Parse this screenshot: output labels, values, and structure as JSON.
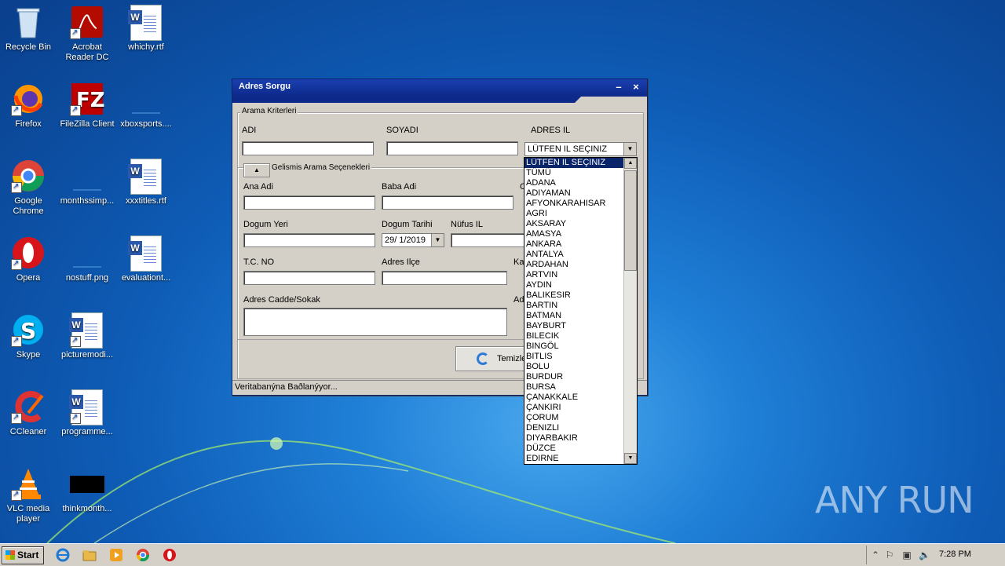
{
  "desktop": {
    "icons": [
      {
        "label": "Recycle Bin",
        "icon": "recycle-bin-icon"
      },
      {
        "label": "Acrobat Reader DC",
        "icon": "acrobat-icon"
      },
      {
        "label": "whichy.rtf",
        "icon": "word-doc-icon"
      },
      {
        "label": "Firefox",
        "icon": "firefox-icon"
      },
      {
        "label": "FileZilla Client",
        "icon": "filezilla-icon"
      },
      {
        "label": "xboxsports....",
        "icon": "blank-file-icon"
      },
      {
        "label": "Google Chrome",
        "icon": "chrome-icon"
      },
      {
        "label": "monthssimp...",
        "icon": "blank-file-icon"
      },
      {
        "label": "xxxtitles.rtf",
        "icon": "word-doc-icon"
      },
      {
        "label": "Opera",
        "icon": "opera-icon"
      },
      {
        "label": "nostuff.png",
        "icon": "blank-file-icon"
      },
      {
        "label": "evaluationt...",
        "icon": "word-doc-icon"
      },
      {
        "label": "Skype",
        "icon": "skype-icon"
      },
      {
        "label": "picturemodi...",
        "icon": "word-doc-icon"
      },
      {
        "label": "CCleaner",
        "icon": "ccleaner-icon"
      },
      {
        "label": "programme...",
        "icon": "word-doc-icon"
      },
      {
        "label": "VLC media player",
        "icon": "vlc-icon"
      },
      {
        "label": "thinkmonth...",
        "icon": "black-thumbnail-icon"
      }
    ]
  },
  "window": {
    "title": "Adres Sorgu",
    "minimize": "–",
    "close": "×",
    "criteria_group": "Arama Kriterleri",
    "adi_label": "ADI",
    "soyadi_label": "SOYADI",
    "adres_il_label": "ADRES IL",
    "adres_il_value": "LÜTFEN IL SEÇINIZ",
    "advanced_group": "Gelismis Arama Seçenekleri",
    "ana_adi_label": "Ana Adi",
    "baba_adi_label": "Baba Adi",
    "cinsiyet_label_partial": "C",
    "dogum_yeri_label": "Dogum Yeri",
    "dogum_tarihi_label": "Dogum Tarihi",
    "dogum_tarihi_value": "29/ 1/2019",
    "nufus_il_label": "Nüfus IL",
    "tc_no_label": "T.C. NO",
    "adres_ilce_label": "Adres Ilçe",
    "ka_label_partial": "Ka",
    "adres_cadde_label": "Adres Cadde/Sokak",
    "ad_label_partial": "Ad",
    "temizle_label": "Temizle",
    "status_text": "Veritabanýna Baðlanýyor..."
  },
  "dropdown": {
    "items": [
      "LÜTFEN IL SEÇINIZ",
      "TÜMÜ",
      "ADANA",
      "ADIYAMAN",
      "AFYONKARAHISAR",
      "AGRI",
      "AKSARAY",
      "AMASYA",
      "ANKARA",
      "ANTALYA",
      "ARDAHAN",
      "ARTVIN",
      "AYDIN",
      "BALIKESIR",
      "BARTIN",
      "BATMAN",
      "BAYBURT",
      "BILECIK",
      "BINGÖL",
      "BITLIS",
      "BOLU",
      "BURDUR",
      "BURSA",
      "ÇANAKKALE",
      "ÇANKIRI",
      "ÇORUM",
      "DENIZLI",
      "DIYARBAKIR",
      "DÜZCE",
      "EDIRNE"
    ],
    "selected_index": 0
  },
  "taskbar": {
    "start_label": "Start",
    "clock": "7:28 PM"
  },
  "watermark": "ANY RUN",
  "colors": {
    "title_bar": "#0d2a8a",
    "selection": "#0a246a"
  }
}
